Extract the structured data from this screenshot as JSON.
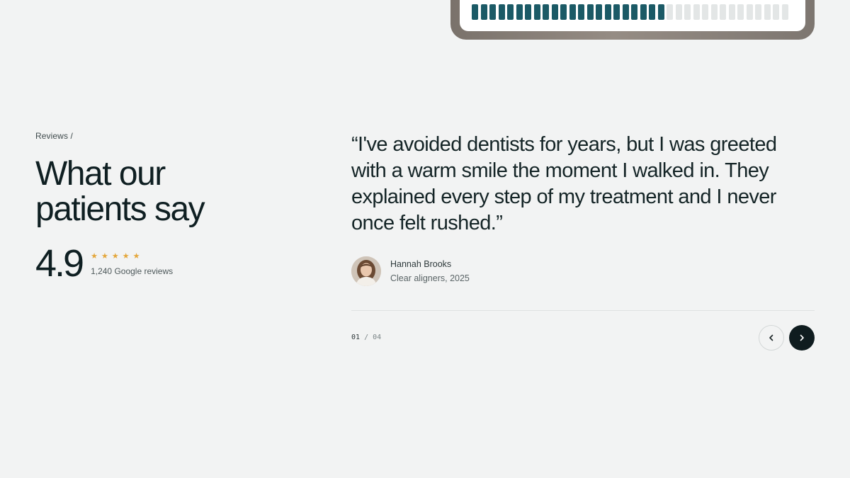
{
  "progress": {
    "filled": 22,
    "total": 36,
    "accent": "#1b5a66"
  },
  "reviews": {
    "breadcrumb": "Reviews /",
    "title_line1": "What our",
    "title_line2": "patients say",
    "score": "4.9",
    "stars": 5,
    "star_color": "#e4a63a",
    "count": "1,240 Google reviews"
  },
  "testimonial": {
    "quote": "“I've avoided dentists for years, but I was greeted with a warm smile the moment I walked in. They explained every step of my treatment and I never once felt rushed.”",
    "author": "Hannah Brooks",
    "role": "Clear aligners, 2025",
    "current": "01",
    "separator": "/",
    "total": "04",
    "prev_icon": "chevron-left-icon",
    "next_icon": "chevron-right-icon"
  }
}
